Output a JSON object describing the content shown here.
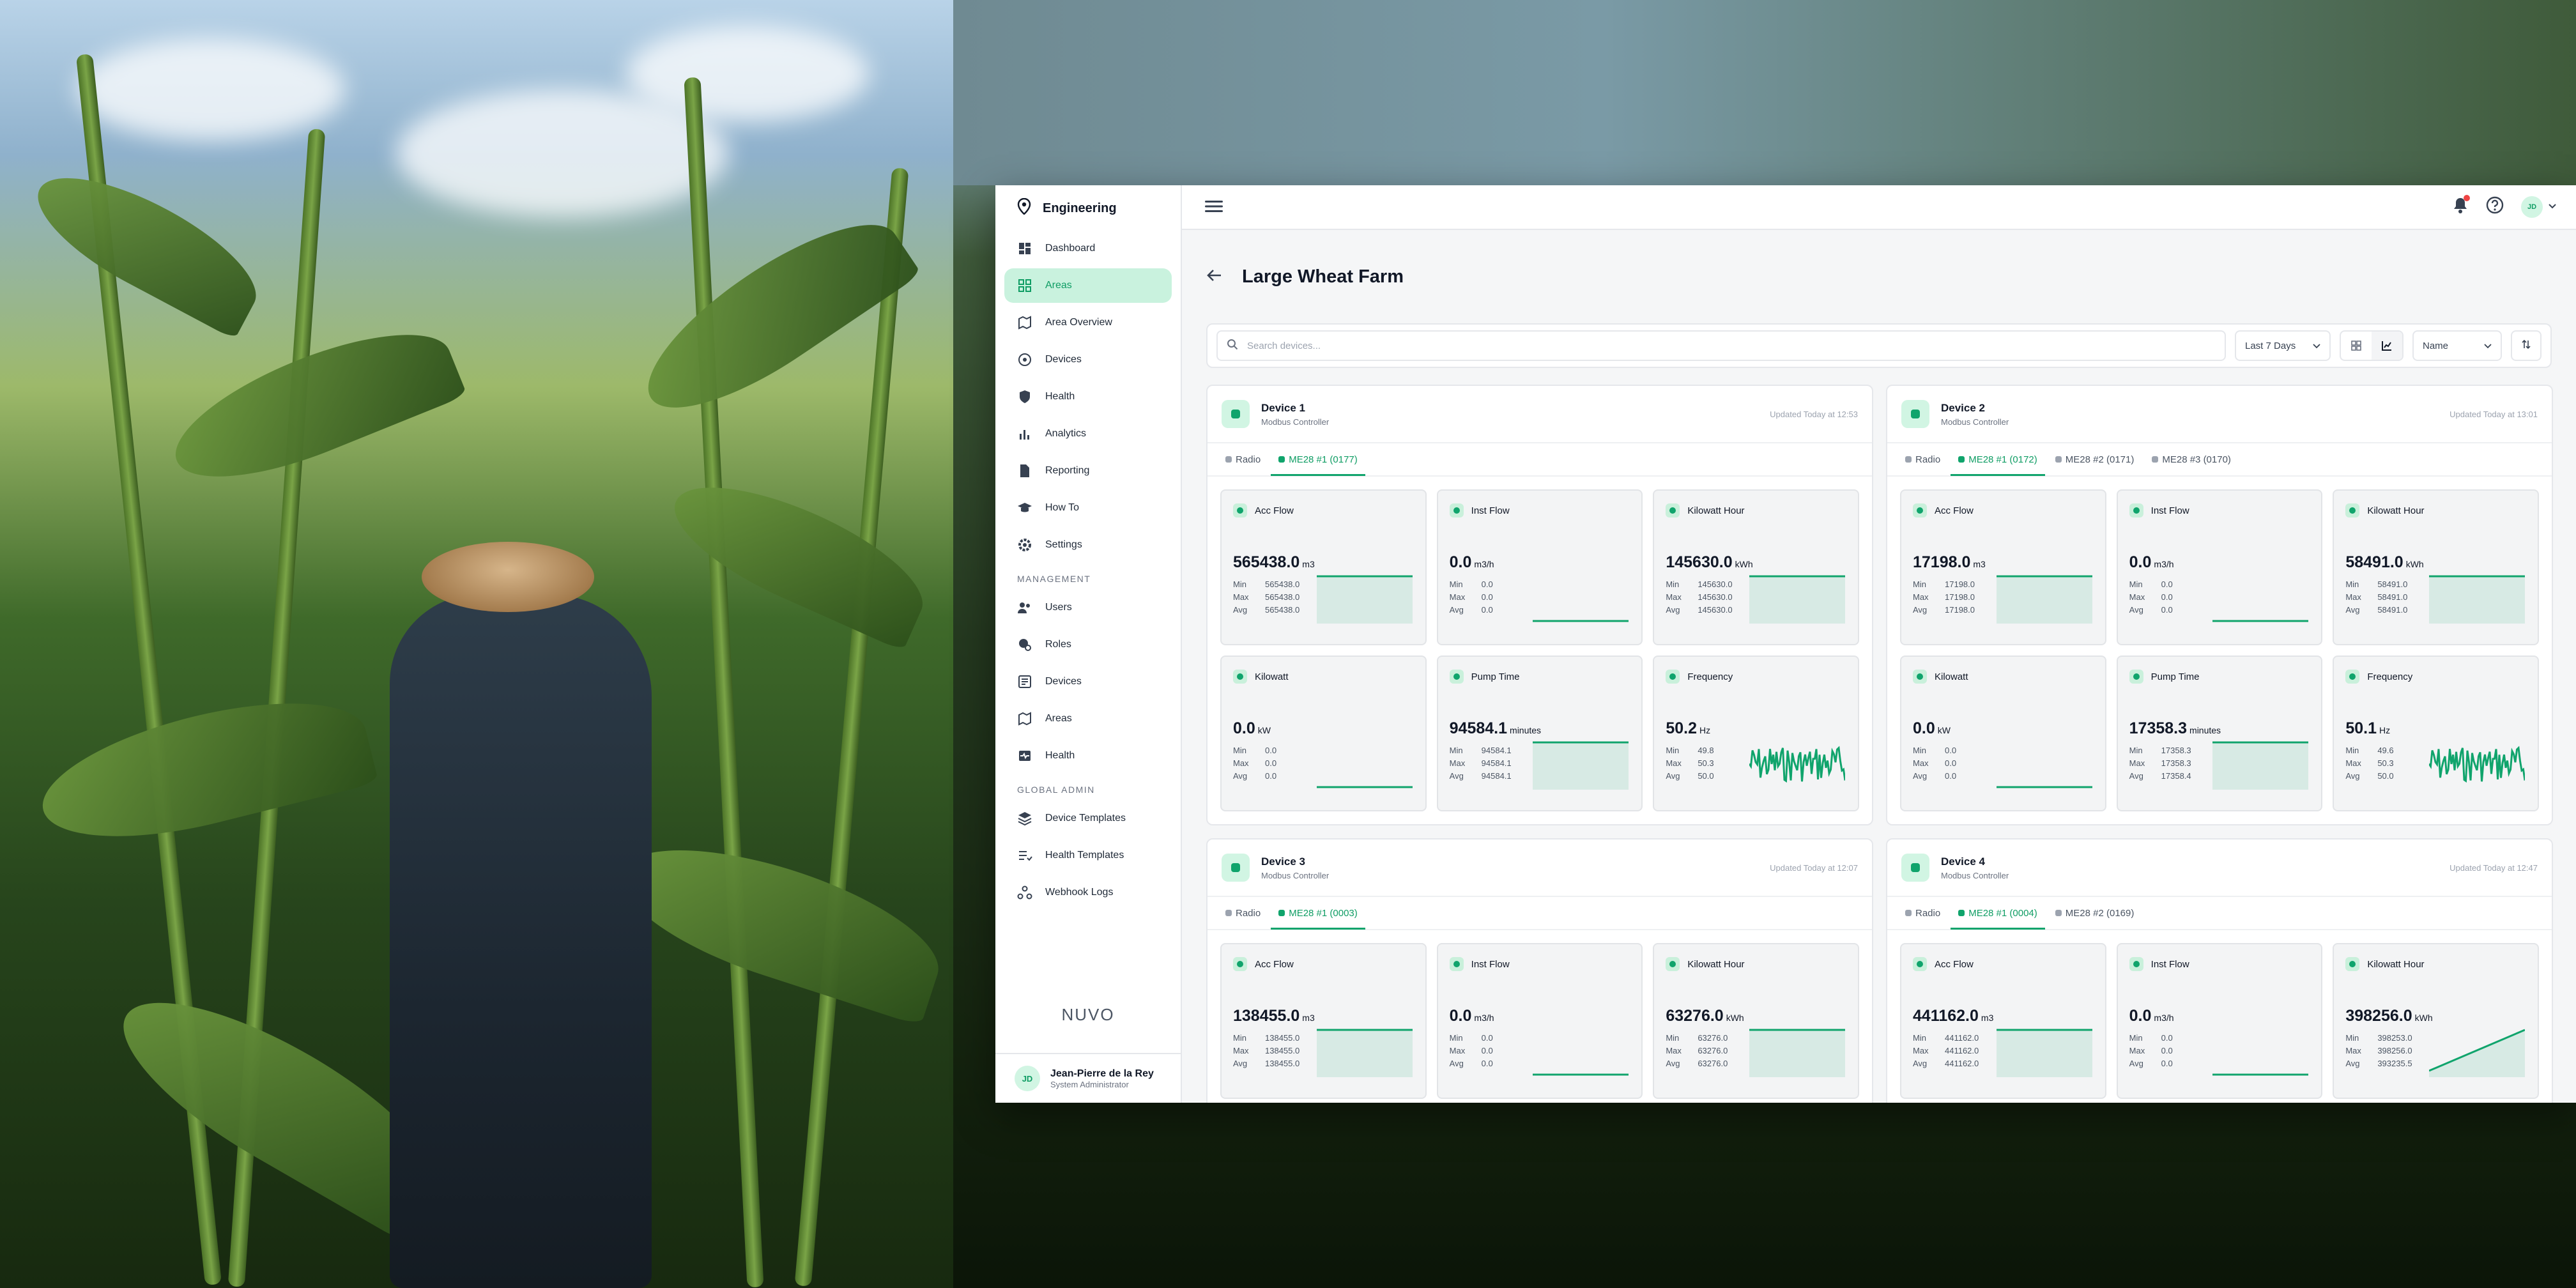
{
  "brand": {
    "name": "Engineering"
  },
  "nav": [
    {
      "label": "Dashboard",
      "icon": "dashboard-icon"
    },
    {
      "label": "Areas",
      "icon": "grid-icon",
      "active": true
    },
    {
      "label": "Area Overview",
      "icon": "map-icon"
    },
    {
      "label": "Devices",
      "icon": "device-icon"
    },
    {
      "label": "Health",
      "icon": "shield-icon"
    },
    {
      "label": "Analytics",
      "icon": "bar-chart-icon"
    },
    {
      "label": "Reporting",
      "icon": "document-icon"
    },
    {
      "label": "How To",
      "icon": "graduation-cap-icon"
    },
    {
      "label": "Settings",
      "icon": "gear-icon"
    }
  ],
  "management": {
    "heading": "MANAGEMENT",
    "items": [
      {
        "label": "Users",
        "icon": "users-icon"
      },
      {
        "label": "Roles",
        "icon": "roles-icon"
      },
      {
        "label": "Devices",
        "icon": "devices-icon"
      },
      {
        "label": "Areas",
        "icon": "map-icon"
      },
      {
        "label": "Health",
        "icon": "health-icon"
      }
    ]
  },
  "global_admin": {
    "heading": "GLOBAL ADMIN",
    "items": [
      {
        "label": "Device Templates",
        "icon": "layers-icon"
      },
      {
        "label": "Health Templates",
        "icon": "list-check-icon"
      },
      {
        "label": "Webhook Logs",
        "icon": "webhook-icon"
      }
    ]
  },
  "footer": {
    "logo": "NUVO",
    "user_initials": "JD",
    "user_name": "Jean-Pierre de la Rey",
    "user_role": "System Administrator"
  },
  "header": {
    "avatar_initials": "JD"
  },
  "page": {
    "title": "Large Wheat Farm"
  },
  "toolbar": {
    "search_placeholder": "Search devices...",
    "range": "Last 7 Days",
    "sort": "Name"
  },
  "colors": {
    "accent": "#10a46c",
    "accent_light": "#c9f2de"
  },
  "devices": [
    {
      "name": "Device 1",
      "type": "Modbus Controller",
      "updated": "Updated Today at 12:53",
      "tabs": [
        "Radio",
        "ME28 #1 (0177)"
      ],
      "active_tab": 1,
      "metrics": [
        {
          "label": "Acc Flow",
          "value": "565438.0",
          "unit": "m3",
          "min": "565438.0",
          "max": "565438.0",
          "avg": "565438.0",
          "trend": "flat-high"
        },
        {
          "label": "Inst Flow",
          "value": "0.0",
          "unit": "m3/h",
          "min": "0.0",
          "max": "0.0",
          "avg": "0.0",
          "trend": "flat-low"
        },
        {
          "label": "Kilowatt Hour",
          "value": "145630.0",
          "unit": "kWh",
          "min": "145630.0",
          "max": "145630.0",
          "avg": "145630.0",
          "trend": "flat-high"
        },
        {
          "label": "Kilowatt",
          "value": "0.0",
          "unit": "kW",
          "min": "0.0",
          "max": "0.0",
          "avg": "0.0",
          "trend": "flat-low"
        },
        {
          "label": "Pump Time",
          "value": "94584.1",
          "unit": "minutes",
          "min": "94584.1",
          "max": "94584.1",
          "avg": "94584.1",
          "trend": "flat-high"
        },
        {
          "label": "Frequency",
          "value": "50.2",
          "unit": "Hz",
          "min": "49.8",
          "max": "50.3",
          "avg": "50.0",
          "trend": "noisy"
        }
      ]
    },
    {
      "name": "Device 2",
      "type": "Modbus Controller",
      "updated": "Updated Today at 13:01",
      "tabs": [
        "Radio",
        "ME28 #1 (0172)",
        "ME28 #2 (0171)",
        "ME28 #3 (0170)"
      ],
      "active_tab": 1,
      "metrics": [
        {
          "label": "Acc Flow",
          "value": "17198.0",
          "unit": "m3",
          "min": "17198.0",
          "max": "17198.0",
          "avg": "17198.0",
          "trend": "flat-high"
        },
        {
          "label": "Inst Flow",
          "value": "0.0",
          "unit": "m3/h",
          "min": "0.0",
          "max": "0.0",
          "avg": "0.0",
          "trend": "flat-low"
        },
        {
          "label": "Kilowatt Hour",
          "value": "58491.0",
          "unit": "kWh",
          "min": "58491.0",
          "max": "58491.0",
          "avg": "58491.0",
          "trend": "flat-high"
        },
        {
          "label": "Kilowatt",
          "value": "0.0",
          "unit": "kW",
          "min": "0.0",
          "max": "0.0",
          "avg": "0.0",
          "trend": "flat-low"
        },
        {
          "label": "Pump Time",
          "value": "17358.3",
          "unit": "minutes",
          "min": "17358.3",
          "max": "17358.3",
          "avg": "17358.4",
          "trend": "flat-high"
        },
        {
          "label": "Frequency",
          "value": "50.1",
          "unit": "Hz",
          "min": "49.6",
          "max": "50.3",
          "avg": "50.0",
          "trend": "noisy"
        }
      ]
    },
    {
      "name": "Device 3",
      "type": "Modbus Controller",
      "updated": "Updated Today at 12:07",
      "tabs": [
        "Radio",
        "ME28 #1 (0003)"
      ],
      "active_tab": 1,
      "metrics": [
        {
          "label": "Acc Flow",
          "value": "138455.0",
          "unit": "m3",
          "min": "138455.0",
          "max": "138455.0",
          "avg": "138455.0",
          "trend": "flat-high"
        },
        {
          "label": "Inst Flow",
          "value": "0.0",
          "unit": "m3/h",
          "min": "0.0",
          "max": "0.0",
          "avg": "0.0",
          "trend": "flat-low"
        },
        {
          "label": "Kilowatt Hour",
          "value": "63276.0",
          "unit": "kWh",
          "min": "63276.0",
          "max": "63276.0",
          "avg": "63276.0",
          "trend": "flat-high"
        }
      ]
    },
    {
      "name": "Device 4",
      "type": "Modbus Controller",
      "updated": "Updated Today at 12:47",
      "tabs": [
        "Radio",
        "ME28 #1 (0004)",
        "ME28 #2 (0169)"
      ],
      "active_tab": 1,
      "metrics": [
        {
          "label": "Acc Flow",
          "value": "441162.0",
          "unit": "m3",
          "min": "441162.0",
          "max": "441162.0",
          "avg": "441162.0",
          "trend": "flat-high"
        },
        {
          "label": "Inst Flow",
          "value": "0.0",
          "unit": "m3/h",
          "min": "0.0",
          "max": "0.0",
          "avg": "0.0",
          "trend": "flat-low"
        },
        {
          "label": "Kilowatt Hour",
          "value": "398256.0",
          "unit": "kWh",
          "min": "398253.0",
          "max": "398256.0",
          "avg": "393235.5",
          "trend": "rising"
        }
      ]
    }
  ]
}
